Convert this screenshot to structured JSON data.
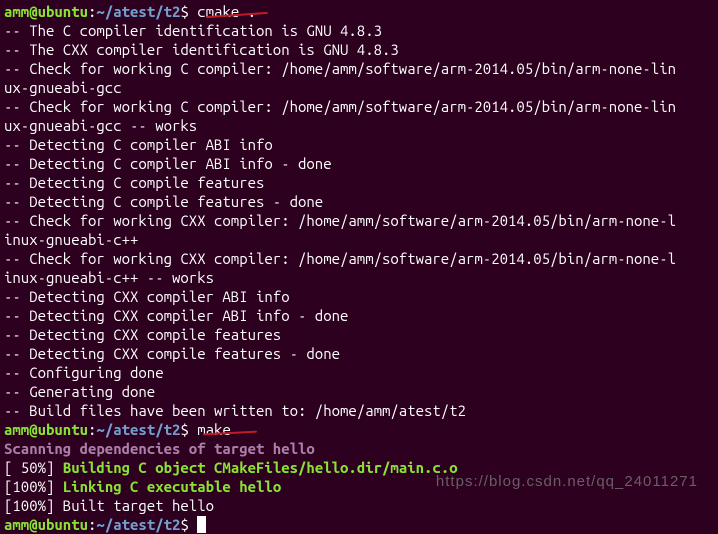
{
  "prompt": {
    "user": "amm",
    "host": "ubuntu",
    "path": "~/atest/t2",
    "dollar": "$"
  },
  "commands": {
    "cmake": "cmake .",
    "make": "make"
  },
  "lines": {
    "l1": "-- The C compiler identification is GNU 4.8.3",
    "l2": "-- The CXX compiler identification is GNU 4.8.3",
    "l3": "-- Check for working C compiler: /home/amm/software/arm-2014.05/bin/arm-none-lin",
    "l4": "ux-gnueabi-gcc",
    "l5": "-- Check for working C compiler: /home/amm/software/arm-2014.05/bin/arm-none-lin",
    "l6": "ux-gnueabi-gcc -- works",
    "l7": "-- Detecting C compiler ABI info",
    "l8": "-- Detecting C compiler ABI info - done",
    "l9": "-- Detecting C compile features",
    "l10": "-- Detecting C compile features - done",
    "l11": "-- Check for working CXX compiler: /home/amm/software/arm-2014.05/bin/arm-none-l",
    "l12": "inux-gnueabi-c++",
    "l13": "-- Check for working CXX compiler: /home/amm/software/arm-2014.05/bin/arm-none-l",
    "l14": "inux-gnueabi-c++ -- works",
    "l15": "-- Detecting CXX compiler ABI info",
    "l16": "-- Detecting CXX compiler ABI info - done",
    "l17": "-- Detecting CXX compile features",
    "l18": "-- Detecting CXX compile features - done",
    "l19": "-- Configuring done",
    "l20": "-- Generating done",
    "l21": "-- Build files have been written to: /home/amm/atest/t2",
    "l22": "Scanning dependencies of target hello",
    "l23a": "[ 50%] ",
    "l23b": "Building C object CMakeFiles/hello.dir/main.c.o",
    "l24a": "[100%] ",
    "l24b": "Linking C executable hello",
    "l25": "[100%] Built target hello"
  },
  "watermark": "https://blog.csdn.net/qq_24011271"
}
